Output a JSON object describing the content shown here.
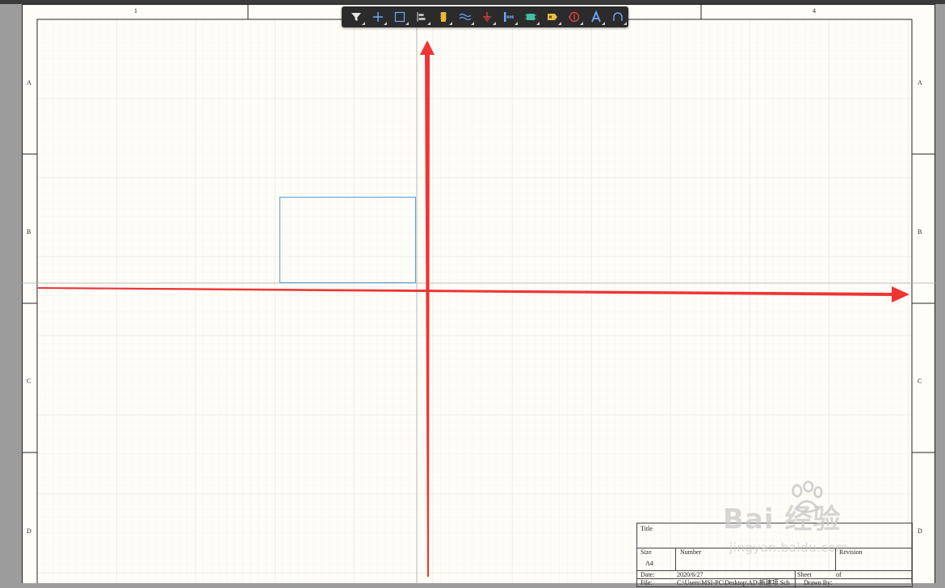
{
  "sheet": {
    "column_labels": [
      "1",
      "4"
    ],
    "row_labels": [
      "A",
      "B",
      "C",
      "D"
    ]
  },
  "toolbar": {
    "tools": [
      {
        "icon": "filter-icon",
        "color": "#e6e6e6"
      },
      {
        "icon": "crosshair-icon",
        "color": "#6fa8ff"
      },
      {
        "icon": "select-rectangle-icon",
        "color": "#6fa8ff"
      },
      {
        "icon": "align-icon",
        "color": "#bdbdbd"
      },
      {
        "icon": "component-icon",
        "color": "#e8b830"
      },
      {
        "icon": "wire-icon",
        "color": "#6fa8ff"
      },
      {
        "icon": "ground-power-icon",
        "color": "#e04040"
      },
      {
        "icon": "bus-icon",
        "color": "#6fa8ff"
      },
      {
        "icon": "sheet-symbol-icon",
        "color": "#40c0a0"
      },
      {
        "icon": "port-icon",
        "color": "#e8c040"
      },
      {
        "icon": "no-erc-icon",
        "color": "#e04040"
      },
      {
        "icon": "text-icon",
        "color": "#6fa8ff"
      },
      {
        "icon": "arc-icon",
        "color": "#6fa8ff"
      }
    ]
  },
  "title_block": {
    "title_label": "Title",
    "size_label": "Size",
    "size_value": "A4",
    "number_label": "Number",
    "revision_label": "Revision",
    "date_label": "Date:",
    "date_value": "2020/6/27",
    "sheet_label": "Sheet",
    "of_label": "of",
    "file_label": "File:",
    "file_value": "C:\\Users\\MSI-PC\\Desktop\\AD\\新建项 Sch",
    "drawn_by_label": "Drawn By:"
  },
  "watermark": {
    "main": "Bai 经验",
    "sub": "jingyan.baidu.com"
  },
  "colors": {
    "arrow": "#ef3434",
    "selection": "#5b9bd5",
    "grid_minor": "#f0ece4",
    "grid_major": "#e2ddd4",
    "sheet_bg": "#fffdf8"
  }
}
